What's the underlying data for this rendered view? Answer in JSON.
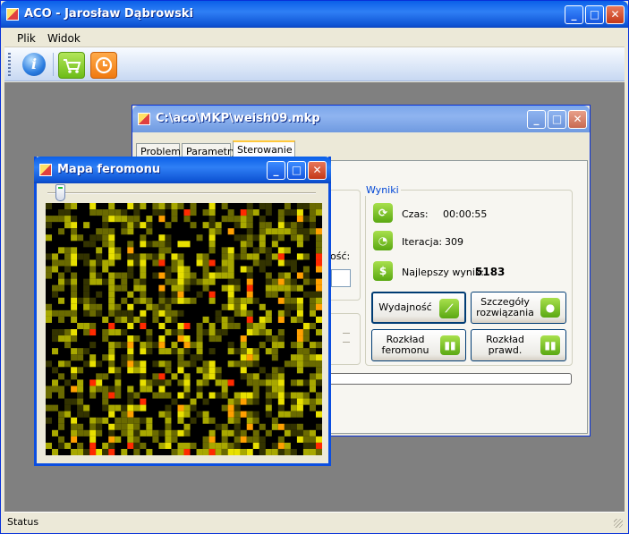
{
  "main_window": {
    "title": "ACO - Jarosław Dąbrowski",
    "menu": [
      "Plik",
      "Widok"
    ],
    "toolbar": [
      "info-icon",
      "cart-icon",
      "clock-icon"
    ],
    "status": "Status"
  },
  "file_window": {
    "title": "C:\\aco\\MKP\\weish09.mkp",
    "tabs": [
      "Problem",
      "Parametry",
      "Sterowanie"
    ],
    "active_tab": "Sterowanie",
    "partial_label": "ość:",
    "results": {
      "legend": "Wyniki",
      "time_label": "Czas:",
      "time_value": "00:00:55",
      "iter_label": "Iteracja:",
      "iter_value": "309",
      "best_label": "Najlepszy wynik:",
      "best_value": "5183"
    },
    "buttons": {
      "performance": "Wydajność",
      "details": "Szczegóły rozwiązania",
      "pheromone_dist": "Rozkład feromonu",
      "prob_dist": "Rozkład prawd."
    },
    "progress_fraction": 0.04
  },
  "pheromone_window": {
    "title": "Mapa feromonu",
    "slider_fraction": 0.03
  },
  "colors": {
    "title_blue": "#0a5fe8",
    "accent_green": "#7cc51c",
    "accent_orange": "#f5891e",
    "heat_low": "#000000",
    "heat_mid": "#c8c800",
    "heat_high": "#ff2a00"
  }
}
